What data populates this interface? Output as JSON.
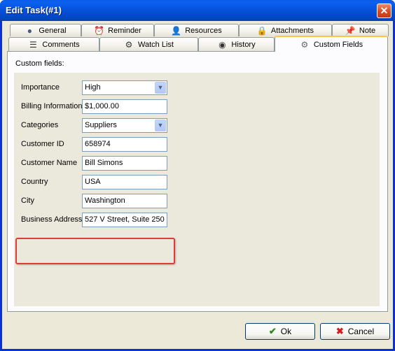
{
  "window": {
    "title": "Edit Task(#1)",
    "close_glyph": "✕"
  },
  "tabs": {
    "row1": [
      {
        "label": "General",
        "icon": "globe-icon",
        "glyph": "●"
      },
      {
        "label": "Reminder",
        "icon": "alarm-clock-icon",
        "glyph": "⏰"
      },
      {
        "label": "Resources",
        "icon": "person-icon",
        "glyph": "👤"
      },
      {
        "label": "Attachments",
        "icon": "lock-icon",
        "glyph": "🔒"
      },
      {
        "label": "Note",
        "icon": "pin-icon",
        "glyph": "📌"
      }
    ],
    "row2": [
      {
        "label": "Comments",
        "icon": "document-icon",
        "glyph": "☰"
      },
      {
        "label": "Watch List",
        "icon": "watch-list-icon",
        "glyph": "⚙"
      },
      {
        "label": "History",
        "icon": "history-icon",
        "glyph": "◉"
      },
      {
        "label": "Custom Fields",
        "icon": "gear-icon",
        "glyph": "⚙"
      }
    ],
    "active": "Custom Fields"
  },
  "custom_fields": {
    "heading": "Custom fields:",
    "fields": [
      {
        "label": "Importance",
        "value": "High",
        "type": "combo"
      },
      {
        "label": "Billing Information",
        "value": "$1,000.00",
        "type": "text"
      },
      {
        "label": "Categories",
        "value": "Suppliers",
        "type": "combo"
      },
      {
        "label": "Customer ID",
        "value": "658974",
        "type": "text"
      },
      {
        "label": "Customer Name",
        "value": "Bill Simons",
        "type": "text"
      },
      {
        "label": "Country",
        "value": "USA",
        "type": "text"
      },
      {
        "label": "City",
        "value": "Washington",
        "type": "text"
      },
      {
        "label": "Business Address",
        "value": "527 V Street, Suite 250",
        "type": "text"
      }
    ],
    "highlighted_field": "Business Address",
    "highlight_color": "#e03a3a"
  },
  "buttons": {
    "ok_label": "Ok",
    "ok_glyph": "✔",
    "ok_color": "#2b8a1a",
    "cancel_label": "Cancel",
    "cancel_glyph": "✖",
    "cancel_color": "#d41e1e"
  }
}
